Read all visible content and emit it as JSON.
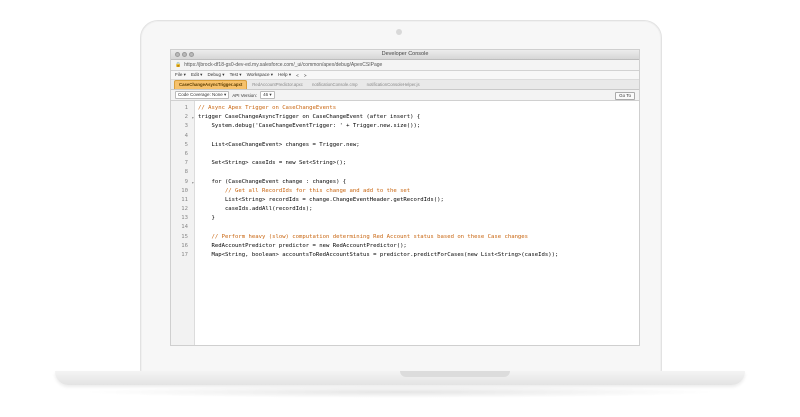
{
  "window": {
    "title": "Developer Console",
    "url": "https://jbrock-df18-gs0-dev-ed.my.salesforce.com/_ui/common/apex/debug/ApexCSIPage"
  },
  "menu": [
    "File ▾",
    "Edit ▾",
    "Debug ▾",
    "Test ▾",
    "Workspace ▾",
    "Help ▾",
    "<",
    ">"
  ],
  "tabs": [
    {
      "label": "CaseChangeAsyncTrigger.apxt",
      "active": true
    },
    {
      "label": "RedAccountPredictor.apxc",
      "active": false
    },
    {
      "label": "notificationConsole.cmp",
      "active": false
    },
    {
      "label": "notificationConsoleHelper.js",
      "active": false
    }
  ],
  "toolbar": {
    "coverage_label": "Code Coverage: None ▾",
    "api_label": "API Version:",
    "api_value": "46 ▾",
    "goto_label": "Go To"
  },
  "code": [
    {
      "n": "1",
      "text": "// Async Apex Trigger on CaseChangeEvents",
      "kind": "comment",
      "fold": ""
    },
    {
      "n": "2",
      "text": "trigger CaseChangeAsyncTrigger on CaseChangeEvent (after insert) {",
      "kind": "code",
      "fold": "▾"
    },
    {
      "n": "3",
      "text": "    System.debug('CaseChangeEventTrigger: ' + Trigger.new.size());",
      "kind": "code",
      "fold": ""
    },
    {
      "n": "4",
      "text": "",
      "kind": "code",
      "fold": ""
    },
    {
      "n": "5",
      "text": "    List<CaseChangeEvent> changes = Trigger.new;",
      "kind": "code",
      "fold": ""
    },
    {
      "n": "6",
      "text": "",
      "kind": "code",
      "fold": ""
    },
    {
      "n": "7",
      "text": "    Set<String> caseIds = new Set<String>();",
      "kind": "code",
      "fold": ""
    },
    {
      "n": "8",
      "text": "",
      "kind": "code",
      "fold": ""
    },
    {
      "n": "9",
      "text": "    for (CaseChangeEvent change : changes) {",
      "kind": "code",
      "fold": "▾"
    },
    {
      "n": "10",
      "text": "        // Get all RecordIds for this change and add to the set",
      "kind": "comment",
      "fold": ""
    },
    {
      "n": "11",
      "text": "        List<String> recordIds = change.ChangeEventHeader.getRecordIds();",
      "kind": "code",
      "fold": ""
    },
    {
      "n": "12",
      "text": "        caseIds.addAll(recordIds);",
      "kind": "code",
      "fold": ""
    },
    {
      "n": "13",
      "text": "    }",
      "kind": "code",
      "fold": ""
    },
    {
      "n": "14",
      "text": "",
      "kind": "code",
      "fold": ""
    },
    {
      "n": "15",
      "text": "    // Perform heavy (slow) computation determining Red Account status based on these Case changes",
      "kind": "comment",
      "fold": ""
    },
    {
      "n": "16",
      "text": "    RedAccountPredictor predictor = new RedAccountPredictor();",
      "kind": "code",
      "fold": ""
    },
    {
      "n": "17",
      "text": "    Map<String, boolean> accountsToRedAccountStatus = predictor.predictForCases(new List<String>(caseIds));",
      "kind": "code",
      "fold": ""
    }
  ],
  "colors": {
    "active_tab": "#f6c16b",
    "comment": "#c8640e"
  }
}
